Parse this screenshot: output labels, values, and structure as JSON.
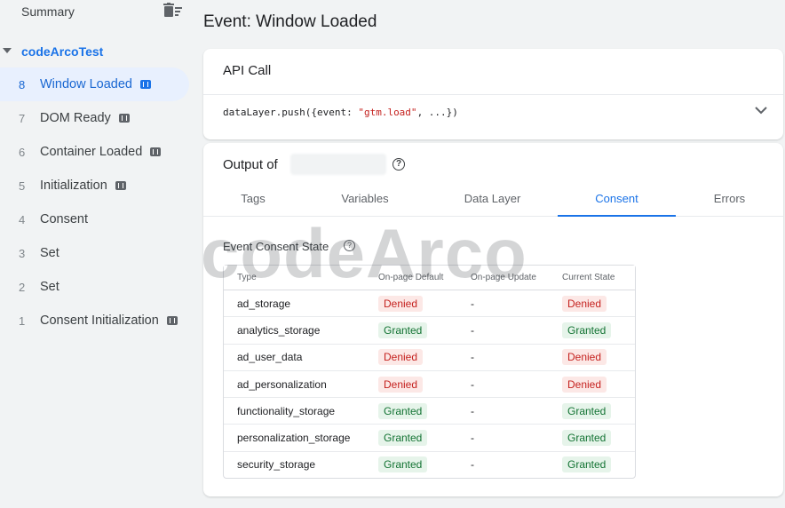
{
  "sidebar": {
    "summary_label": "Summary",
    "container_name": "codeArcoTest",
    "events": [
      {
        "num": "8",
        "label": "Window Loaded",
        "badge": true,
        "active": true
      },
      {
        "num": "7",
        "label": "DOM Ready",
        "badge": true
      },
      {
        "num": "6",
        "label": "Container Loaded",
        "badge": true
      },
      {
        "num": "5",
        "label": "Initialization",
        "badge": true
      },
      {
        "num": "4",
        "label": "Consent",
        "badge": false
      },
      {
        "num": "3",
        "label": "Set",
        "badge": false
      },
      {
        "num": "2",
        "label": "Set",
        "badge": false
      },
      {
        "num": "1",
        "label": "Consent Initialization",
        "badge": true
      }
    ]
  },
  "main": {
    "title": "Event: Window Loaded",
    "api_call": {
      "title": "API Call",
      "code_prefix": "dataLayer.push({event: ",
      "code_string": "\"gtm.load\"",
      "code_suffix": ", ...})"
    },
    "output": {
      "title": "Output of",
      "help": "?",
      "tabs": [
        "Tags",
        "Variables",
        "Data Layer",
        "Consent",
        "Errors"
      ],
      "active_tab": "Consent",
      "section_title": "Event Consent State",
      "table": {
        "headers": [
          "Type",
          "On-page Default",
          "On-page Update",
          "Current State"
        ],
        "rows": [
          [
            "ad_storage",
            "Denied",
            "-",
            "Denied"
          ],
          [
            "analytics_storage",
            "Granted",
            "-",
            "Granted"
          ],
          [
            "ad_user_data",
            "Denied",
            "-",
            "Denied"
          ],
          [
            "ad_personalization",
            "Denied",
            "-",
            "Denied"
          ],
          [
            "functionality_storage",
            "Granted",
            "-",
            "Granted"
          ],
          [
            "personalization_storage",
            "Granted",
            "-",
            "Granted"
          ],
          [
            "security_storage",
            "Granted",
            "-",
            "Granted"
          ]
        ]
      }
    }
  },
  "watermark": "codeArco",
  "colors": {
    "accent": "#1a73e8",
    "denied_bg": "#fce8e6",
    "denied_fg": "#c5221f",
    "granted_bg": "#e6f4ea",
    "granted_fg": "#137333"
  }
}
